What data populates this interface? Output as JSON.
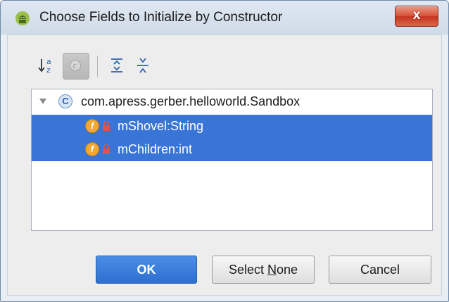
{
  "window": {
    "title": "Choose Fields to Initialize by Constructor",
    "close_glyph": "x"
  },
  "toolbar": {
    "items": [
      {
        "name": "sort-alphabetically-icon"
      },
      {
        "name": "show-classes-icon"
      },
      {
        "name": "expand-all-icon"
      },
      {
        "name": "collapse-all-icon"
      }
    ]
  },
  "tree": {
    "root": {
      "label": "com.apress.gerber.helloworld.Sandbox",
      "icon_letter": "C",
      "expanded": true
    },
    "fields": [
      {
        "label": "mShovel:String",
        "icon_letter": "f",
        "selected": true
      },
      {
        "label": "mChildren:int",
        "icon_letter": "f",
        "selected": true
      }
    ]
  },
  "buttons": {
    "ok": "OK",
    "select_none_pre": "Select ",
    "select_none_mnemonic": "N",
    "select_none_post": "one",
    "cancel": "Cancel"
  },
  "colors": {
    "selection": "#3875d7",
    "default_button": "#3b7ddd",
    "close_button": "#d2462d"
  }
}
